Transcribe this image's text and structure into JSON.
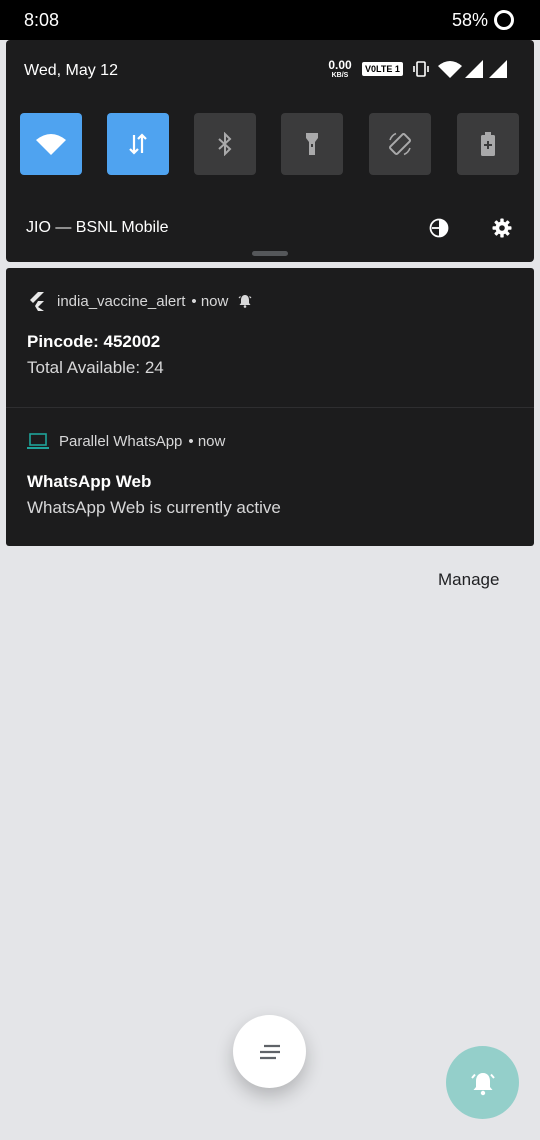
{
  "status_bar": {
    "time": "8:08",
    "battery": "58%",
    "icons": [
      "battery-saver-ring-icon"
    ]
  },
  "quick_settings": {
    "date": "Wed, May 12",
    "net_speed_value": "0.00",
    "net_speed_unit": "KB/S",
    "volte": "V0LTE 1",
    "status_icons": [
      "vibrate-icon",
      "wifi-icon",
      "signal-icon",
      "signal-icon"
    ],
    "carrier": "JIO — BSNL Mobile",
    "tiles": [
      {
        "icon": "wifi-icon",
        "active": true
      },
      {
        "icon": "mobile-data-icon",
        "active": true
      },
      {
        "icon": "bluetooth-icon",
        "active": false
      },
      {
        "icon": "flashlight-icon",
        "active": false
      },
      {
        "icon": "auto-rotate-icon",
        "active": false
      },
      {
        "icon": "battery-saver-icon",
        "active": false
      }
    ],
    "accent_color": "#4fa3f0"
  },
  "notifications": [
    {
      "app": "india_vaccine_alert",
      "meta": "• now",
      "app_icon": "flutter-icon",
      "alert_icon": "bell-icon",
      "title": "Pincode: 452002",
      "text": "Total Available: 24"
    },
    {
      "app": "Parallel WhatsApp",
      "meta": "• now",
      "app_icon": "laptop-icon",
      "title": "WhatsApp Web",
      "text": "WhatsApp Web is currently active"
    }
  ],
  "manage_label": "Manage",
  "fab_icons": [
    "notification-list-icon",
    "dnd-bell-icon"
  ]
}
